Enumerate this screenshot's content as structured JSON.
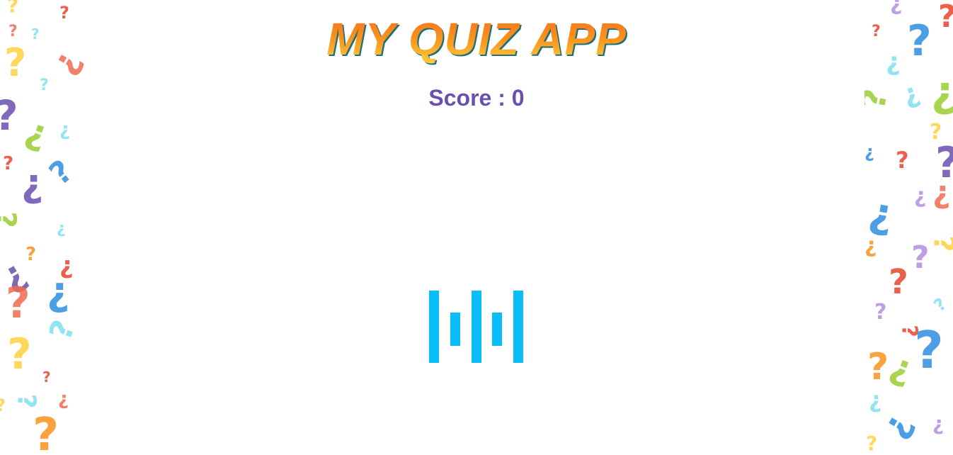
{
  "app": {
    "title": "MY QUIZ APP",
    "score_label": "Score : 0"
  },
  "loader": {
    "icon": "loading-bars-icon",
    "color": "#0abcf8"
  },
  "decoration": {
    "glyphs": [
      "?",
      "¿"
    ],
    "palette": [
      "#e8452c",
      "#f7941d",
      "#ffd23f",
      "#9acd32",
      "#6b4fb0",
      "#2d8fe0",
      "#7fe0f0",
      "#b58fe0",
      "#f26b4f"
    ]
  }
}
